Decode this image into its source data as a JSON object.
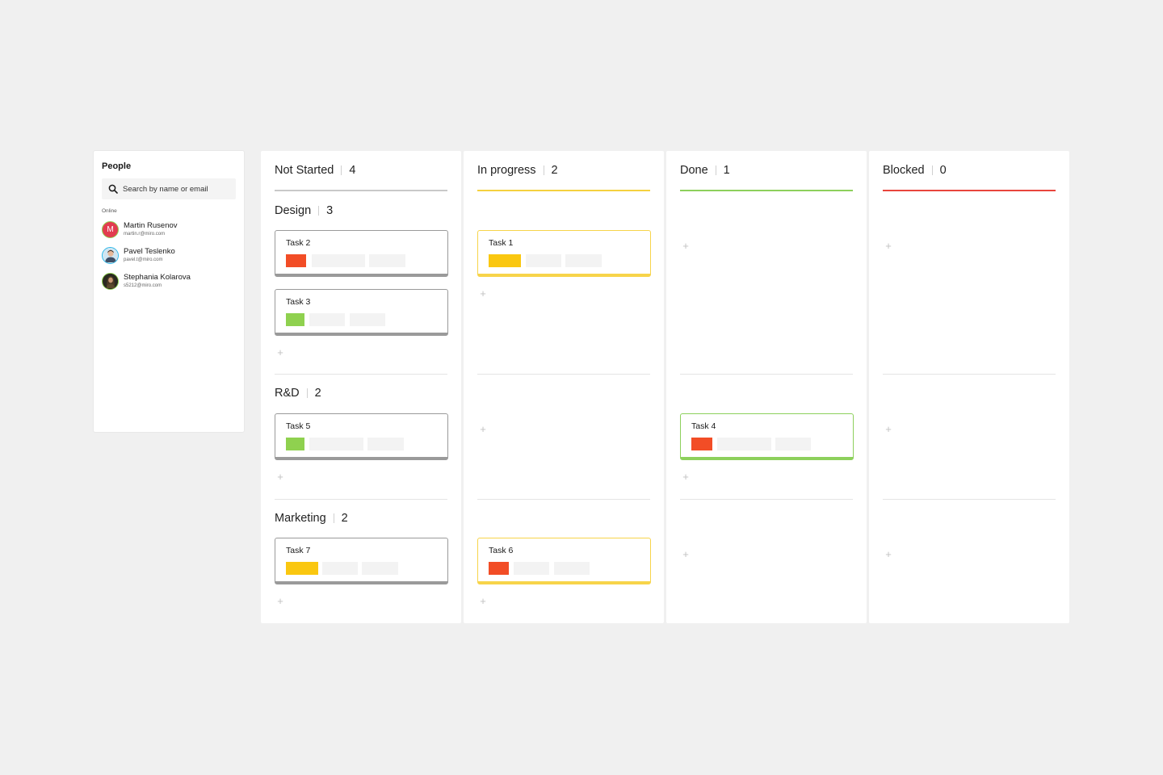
{
  "people_panel": {
    "title": "People",
    "search_placeholder": "Search by name or email",
    "online_label": "Online",
    "people": [
      {
        "name": "Martin Rusenov",
        "email": "martin.r@miro.com",
        "initial": "M"
      },
      {
        "name": "Pavel Teslenko",
        "email": "pavel.t@miro.com"
      },
      {
        "name": "Stephania Kolarova",
        "email": "s5212@miro.com"
      }
    ]
  },
  "columns": [
    {
      "name": "Not Started",
      "count": "4",
      "color": "#c9c9c9"
    },
    {
      "name": "In progress",
      "count": "2",
      "color": "#f5d13f"
    },
    {
      "name": "Done",
      "count": "1",
      "color": "#8dd05c"
    },
    {
      "name": "Blocked",
      "count": "0",
      "color": "#e8453c"
    }
  ],
  "groups": [
    {
      "name": "Design",
      "count": "3"
    },
    {
      "name": "R&D",
      "count": "2"
    },
    {
      "name": "Marketing",
      "count": "2"
    }
  ],
  "tasks": {
    "task2": {
      "label": "Task 2",
      "tag_color": "#f24d26"
    },
    "task3": {
      "label": "Task 3",
      "tag_color": "#8fd14f"
    },
    "task1": {
      "label": "Task 1",
      "tag_color": "#fac710"
    },
    "task5": {
      "label": "Task 5",
      "tag_color": "#8fd14f"
    },
    "task4": {
      "label": "Task 4",
      "tag_color": "#f24d26"
    },
    "task7": {
      "label": "Task 7",
      "tag_color": "#fac710"
    },
    "task6": {
      "label": "Task 6",
      "tag_color": "#f24d26"
    }
  },
  "add_symbol": "+"
}
